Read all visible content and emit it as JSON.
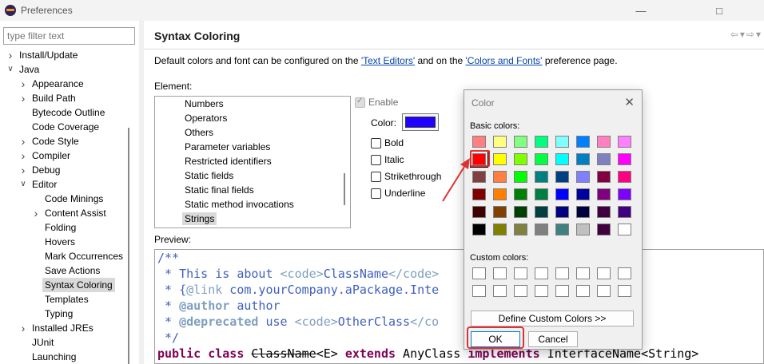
{
  "window": {
    "title": "Preferences"
  },
  "filter": {
    "placeholder": "type filter text"
  },
  "tree": [
    {
      "label": "Install/Update",
      "depth": 0,
      "expander": ">"
    },
    {
      "label": "Java",
      "depth": 0,
      "expander": "v"
    },
    {
      "label": "Appearance",
      "depth": 1,
      "expander": ">"
    },
    {
      "label": "Build Path",
      "depth": 1,
      "expander": ">"
    },
    {
      "label": "Bytecode Outline",
      "depth": 1,
      "expander": ""
    },
    {
      "label": "Code Coverage",
      "depth": 1,
      "expander": ""
    },
    {
      "label": "Code Style",
      "depth": 1,
      "expander": ">"
    },
    {
      "label": "Compiler",
      "depth": 1,
      "expander": ">"
    },
    {
      "label": "Debug",
      "depth": 1,
      "expander": ">"
    },
    {
      "label": "Editor",
      "depth": 1,
      "expander": "v"
    },
    {
      "label": "Code Minings",
      "depth": 2,
      "expander": ""
    },
    {
      "label": "Content Assist",
      "depth": 2,
      "expander": ">"
    },
    {
      "label": "Folding",
      "depth": 2,
      "expander": ""
    },
    {
      "label": "Hovers",
      "depth": 2,
      "expander": ""
    },
    {
      "label": "Mark Occurrences",
      "depth": 2,
      "expander": ""
    },
    {
      "label": "Save Actions",
      "depth": 2,
      "expander": ""
    },
    {
      "label": "Syntax Coloring",
      "depth": 2,
      "expander": "",
      "selected": true
    },
    {
      "label": "Templates",
      "depth": 2,
      "expander": ""
    },
    {
      "label": "Typing",
      "depth": 2,
      "expander": ""
    },
    {
      "label": "Installed JREs",
      "depth": 1,
      "expander": ">"
    },
    {
      "label": "JUnit",
      "depth": 1,
      "expander": ""
    },
    {
      "label": "Launching",
      "depth": 1,
      "expander": ""
    }
  ],
  "page": {
    "title": "Syntax Coloring",
    "desc_prefix": "Default colors and font can be configured on the ",
    "link1": "'Text Editors'",
    "desc_mid": " and on the ",
    "link2": "'Colors and Fonts'",
    "desc_suffix": " preference page.",
    "element_label": "Element:",
    "elements": [
      "Numbers",
      "Operators",
      "Others",
      "Parameter variables",
      "Restricted identifiers",
      "Static fields",
      "Static final fields",
      "Static method invocations",
      "Strings"
    ],
    "selected_element": "Strings",
    "enable_label": "Enable",
    "color_label": "Color:",
    "current_color": "#2000ff",
    "bold_label": "Bold",
    "italic_label": "Italic",
    "strike_label": "Strikethrough",
    "underline_label": "Underline",
    "preview_label": "Preview:"
  },
  "preview_lines": [
    [
      {
        "t": "/**",
        "c": "jd"
      }
    ],
    [
      {
        "t": " * This is about ",
        "c": "jd"
      },
      {
        "t": "<code>",
        "c": "jdtag"
      },
      {
        "t": "ClassName",
        "c": "jd"
      },
      {
        "t": "</code>",
        "c": "jdtag"
      }
    ],
    [
      {
        "t": " * {",
        "c": "jd"
      },
      {
        "t": "@link",
        "c": "jdtag"
      },
      {
        "t": " com.yourCompany.aPackage.Inte",
        "c": "jd"
      }
    ],
    [
      {
        "t": " * ",
        "c": "jd"
      },
      {
        "t": "@author",
        "c": "jdkw"
      },
      {
        "t": " author",
        "c": "jd"
      }
    ],
    [
      {
        "t": " * ",
        "c": "jd"
      },
      {
        "t": "@deprecated",
        "c": "jdkw"
      },
      {
        "t": " use ",
        "c": "jd"
      },
      {
        "t": "<code>",
        "c": "jdtag"
      },
      {
        "t": "OtherClass",
        "c": "jd"
      },
      {
        "t": "</co",
        "c": "jdtag"
      }
    ],
    [
      {
        "t": " */",
        "c": "jd"
      }
    ],
    [
      {
        "t": "public",
        "c": "kw"
      },
      {
        "t": " ",
        "c": ""
      },
      {
        "t": "class",
        "c": "kw"
      },
      {
        "t": " ",
        "c": ""
      },
      {
        "t": "ClassName",
        "c": "strike"
      },
      {
        "t": "<E> ",
        "c": ""
      },
      {
        "t": "extends",
        "c": "kw"
      },
      {
        "t": " AnyClass ",
        "c": ""
      },
      {
        "t": "implements",
        "c": "kw"
      },
      {
        "t": " InterfaceName<String>",
        "c": ""
      }
    ]
  ],
  "color_dialog": {
    "title": "Color",
    "basic_label": "Basic colors:",
    "custom_label": "Custom colors:",
    "define_button": "Define Custom Colors >>",
    "ok_button": "OK",
    "cancel_button": "Cancel",
    "selected_color": "#ff0000",
    "basic_colors": [
      [
        "#ff8080",
        "#ffff80",
        "#80ff80",
        "#00ff80",
        "#80ffff",
        "#0080ff",
        "#ff80c0",
        "#ff80ff"
      ],
      [
        "#ff0000",
        "#ffff00",
        "#80ff00",
        "#00ff40",
        "#00ffff",
        "#0080c0",
        "#8080c0",
        "#ff00ff"
      ],
      [
        "#804040",
        "#ff8040",
        "#00ff00",
        "#008080",
        "#004080",
        "#8080ff",
        "#800040",
        "#ff0080"
      ],
      [
        "#800000",
        "#ff8000",
        "#008000",
        "#008040",
        "#0000ff",
        "#0000a0",
        "#800080",
        "#8000ff"
      ],
      [
        "#400000",
        "#804000",
        "#004000",
        "#004040",
        "#000080",
        "#000040",
        "#400040",
        "#400080"
      ],
      [
        "#000000",
        "#808000",
        "#808040",
        "#808080",
        "#408080",
        "#c0c0c0",
        "#400040",
        "#ffffff"
      ]
    ],
    "custom_colors": [
      [
        "#ffffff",
        "#ffffff",
        "#ffffff",
        "#ffffff",
        "#ffffff",
        "#ffffff",
        "#ffffff",
        "#ffffff"
      ],
      [
        "#ffffff",
        "#ffffff",
        "#ffffff",
        "#ffffff",
        "#ffffff",
        "#ffffff",
        "#ffffff",
        "#ffffff"
      ]
    ]
  },
  "annotation_color": "#e03030"
}
